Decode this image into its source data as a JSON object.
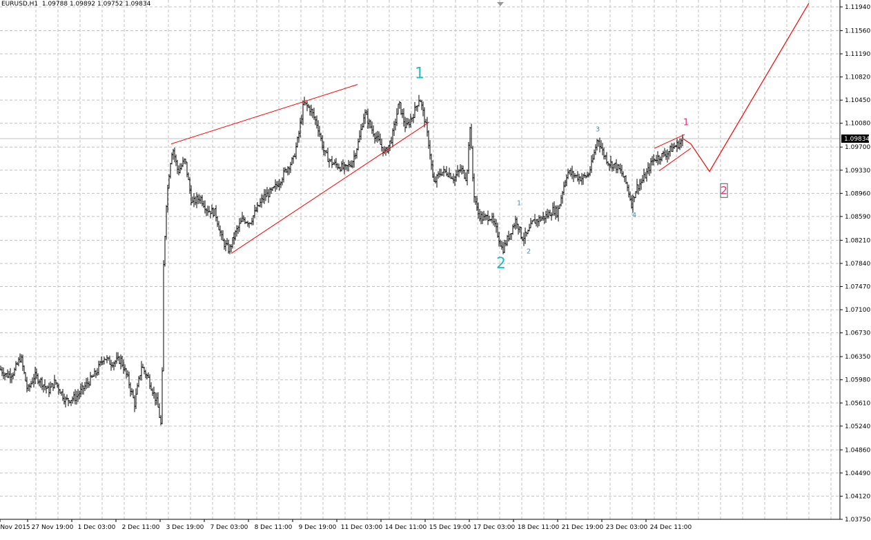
{
  "header": {
    "symbol": "EURUSD,H1",
    "ohlc": "1.09788 1.09892 1.09752 1.09834"
  },
  "colors": {
    "background": "#ffffff",
    "grid": "#c0c0c0",
    "candle": "#000000",
    "trendline": "#ff0000",
    "wave_cyan": "#1fbfbf",
    "wave_small": "#4a8fa0",
    "wave_pink": "#e0307a",
    "price_line": "#c0c0c0",
    "price_badge_bg": "#000000",
    "price_badge_text": "#ffffff"
  },
  "chart_data": {
    "type": "candlestick",
    "title": "EURUSD,H1",
    "ylim": [
      1.0375,
      1.1194
    ],
    "y_ticks": [
      "1.11940",
      "1.11560",
      "1.11190",
      "1.10820",
      "1.10450",
      "1.10080",
      "1.09700",
      "1.09330",
      "1.08960",
      "1.08590",
      "1.08210",
      "1.07840",
      "1.07470",
      "1.07100",
      "1.06730",
      "1.06350",
      "1.05980",
      "1.05610",
      "1.05240",
      "1.04860",
      "1.04490",
      "1.04120",
      "1.03750"
    ],
    "x_ticks": [
      "Nov 2015",
      "27 Nov 19:00",
      "1 Dec 03:00",
      "2 Dec 11:00",
      "3 Dec 19:00",
      "7 Dec 03:00",
      "8 Dec 11:00",
      "9 Dec 19:00",
      "11 Dec 03:00",
      "14 Dec 11:00",
      "15 Dec 19:00",
      "17 Dec 03:00",
      "18 Dec 11:00",
      "21 Dec 19:00",
      "23 Dec 03:00",
      "24 Dec 11:00"
    ],
    "current_price": "1.09834",
    "grid": true,
    "price_path": [
      [
        0,
        1.0615
      ],
      [
        10,
        1.0605
      ],
      [
        20,
        1.061
      ],
      [
        30,
        1.0635
      ],
      [
        40,
        1.058
      ],
      [
        50,
        1.0605
      ],
      [
        60,
        1.0595
      ],
      [
        70,
        1.058
      ],
      [
        80,
        1.0595
      ],
      [
        95,
        1.0565
      ],
      [
        110,
        1.057
      ],
      [
        125,
        1.059
      ],
      [
        140,
        1.061
      ],
      [
        150,
        1.0635
      ],
      [
        160,
        1.0625
      ],
      [
        175,
        1.063
      ],
      [
        185,
        1.06
      ],
      [
        195,
        1.056
      ],
      [
        205,
        1.062
      ],
      [
        215,
        1.06
      ],
      [
        228,
        1.056
      ],
      [
        234,
        1.052
      ],
      [
        237,
        1.078
      ],
      [
        241,
        1.088
      ],
      [
        246,
        1.094
      ],
      [
        250,
        1.097
      ],
      [
        258,
        1.093
      ],
      [
        268,
        1.095
      ],
      [
        278,
        1.088
      ],
      [
        290,
        1.089
      ],
      [
        300,
        1.087
      ],
      [
        312,
        1.0865
      ],
      [
        322,
        1.082
      ],
      [
        332,
        1.0805
      ],
      [
        342,
        1.0835
      ],
      [
        352,
        1.0855
      ],
      [
        362,
        1.085
      ],
      [
        372,
        1.087
      ],
      [
        382,
        1.089
      ],
      [
        395,
        1.09
      ],
      [
        405,
        1.0915
      ],
      [
        415,
        1.0935
      ],
      [
        425,
        1.095
      ],
      [
        432,
        1.0985
      ],
      [
        440,
        1.104
      ],
      [
        450,
        1.103
      ],
      [
        460,
        1.1005
      ],
      [
        470,
        1.096
      ],
      [
        480,
        1.0945
      ],
      [
        490,
        1.094
      ],
      [
        500,
        1.0935
      ],
      [
        510,
        1.0945
      ],
      [
        520,
        1.098
      ],
      [
        528,
        1.1025
      ],
      [
        538,
        1.1
      ],
      [
        548,
        1.098
      ],
      [
        558,
        1.096
      ],
      [
        568,
        1.0985
      ],
      [
        578,
        1.104
      ],
      [
        588,
        1.1
      ],
      [
        598,
        1.102
      ],
      [
        608,
        1.105
      ],
      [
        616,
        1.101
      ],
      [
        622,
        1.097
      ],
      [
        628,
        1.091
      ],
      [
        638,
        1.093
      ],
      [
        648,
        1.093
      ],
      [
        658,
        1.092
      ],
      [
        668,
        1.0935
      ],
      [
        676,
        1.092
      ],
      [
        681,
        1.1005
      ],
      [
        686,
        1.09
      ],
      [
        692,
        1.0865
      ],
      [
        700,
        1.0855
      ],
      [
        710,
        1.086
      ],
      [
        720,
        1.0835
      ],
      [
        728,
        1.0805
      ],
      [
        738,
        1.083
      ],
      [
        748,
        1.0855
      ],
      [
        756,
        1.0825
      ],
      [
        764,
        1.083
      ],
      [
        772,
        1.085
      ],
      [
        782,
        1.0855
      ],
      [
        792,
        1.086
      ],
      [
        802,
        1.087
      ],
      [
        808,
        1.0865
      ],
      [
        815,
        1.09
      ],
      [
        822,
        1.093
      ],
      [
        832,
        1.0925
      ],
      [
        842,
        1.092
      ],
      [
        852,
        1.0925
      ],
      [
        858,
        1.0945
      ],
      [
        866,
        1.0985
      ],
      [
        874,
        1.096
      ],
      [
        882,
        1.0945
      ],
      [
        892,
        1.094
      ],
      [
        900,
        1.093
      ],
      [
        908,
        1.091
      ],
      [
        915,
        1.088
      ],
      [
        922,
        1.0905
      ],
      [
        930,
        1.0915
      ],
      [
        938,
        1.093
      ],
      [
        946,
        1.095
      ],
      [
        956,
        1.0955
      ],
      [
        966,
        1.096
      ],
      [
        976,
        1.097
      ],
      [
        984,
        1.0975
      ],
      [
        990,
        1.0983
      ]
    ],
    "projection_path": [
      [
        990,
        1.0983
      ],
      [
        1001,
        1.0975
      ],
      [
        1028,
        1.0931
      ],
      [
        1172,
        1.12
      ]
    ],
    "trendlines": [
      {
        "name": "upper-channel-line",
        "from": [
          248,
          1.0975
        ],
        "to": [
          518,
          1.107
        ]
      },
      {
        "name": "lower-channel-line",
        "from": [
          335,
          1.08
        ],
        "to": [
          622,
          1.101
        ]
      },
      {
        "name": "wedge-upper-line",
        "from": [
          948,
          1.0968
        ],
        "to": [
          992,
          1.099
        ]
      },
      {
        "name": "wedge-lower-line",
        "from": [
          955,
          1.0932
        ],
        "to": [
          1001,
          1.0968
        ]
      }
    ],
    "wave_labels": [
      {
        "text": "1",
        "x": 608,
        "price": 1.108,
        "size": "large",
        "color": "cyan"
      },
      {
        "text": "2",
        "x": 726,
        "price": 1.0776,
        "size": "large",
        "color": "cyan"
      },
      {
        "text": "1",
        "x": 752,
        "price": 1.0877,
        "size": "small",
        "color": "small"
      },
      {
        "text": "2",
        "x": 766,
        "price": 1.08,
        "size": "small",
        "color": "small"
      },
      {
        "text": "3",
        "x": 866,
        "price": 1.0995,
        "size": "small",
        "color": "small"
      },
      {
        "text": "4",
        "x": 919,
        "price": 1.0858,
        "size": "small",
        "color": "small"
      },
      {
        "text": "1",
        "x": 994,
        "price": 1.1005,
        "size": "medium",
        "color": "pink"
      },
      {
        "text": "2",
        "x": 1049,
        "price": 1.0895,
        "size": "boxed",
        "color": "pink"
      }
    ]
  }
}
